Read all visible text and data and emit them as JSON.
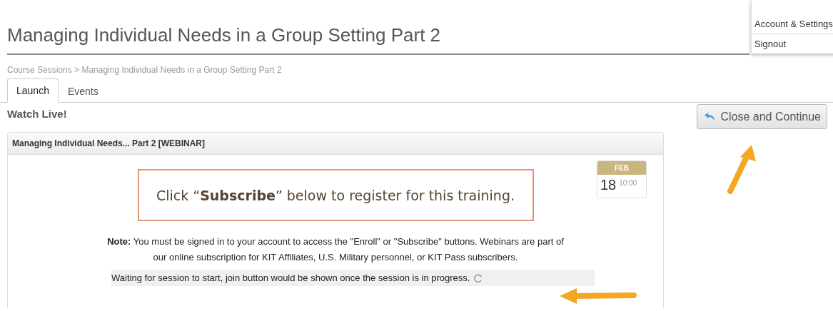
{
  "page_title": "Managing Individual Needs in a Group Setting Part 2",
  "breadcrumb": "Course Sessions > Managing Individual Needs in a Group Setting Part 2",
  "tabs": [
    {
      "label": "Launch",
      "selected": true
    },
    {
      "label": "Events",
      "selected": false
    }
  ],
  "section_heading": "Watch Live!",
  "close_button": "Close and Continue",
  "user_menu": [
    "Account & Settings",
    "Signout"
  ],
  "panel": {
    "title": "Managing Individual Needs... Part 2 [WEBINAR]",
    "callout": "Click “**Subscribe**” below to register for this training.",
    "date": {
      "month": "FEB",
      "day": "18",
      "time": "10:00"
    },
    "note": "**Note:** You must be signed in to your account to access the \"Enroll\" or \"Subscribe\" buttons. Webinars are part of our online subscription for KIT Affiliates, U.S. Military personnel, or KIT Pass subscribers.",
    "status": "Waiting for session to start, join button would be shown once the session is in progress."
  }
}
